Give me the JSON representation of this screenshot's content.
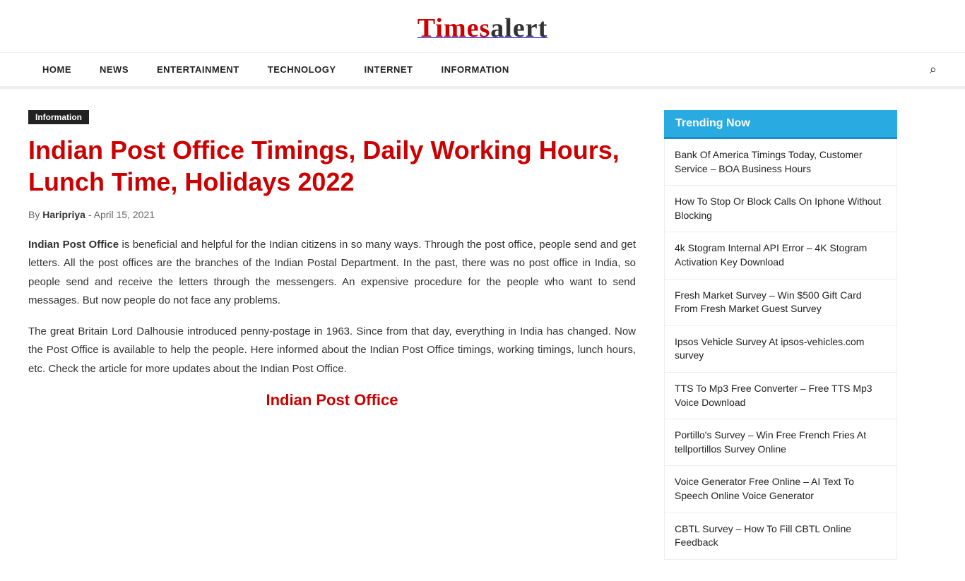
{
  "site": {
    "name_times": "Times",
    "name_alert": "alert"
  },
  "nav": {
    "items": [
      {
        "label": "HOME",
        "href": "#"
      },
      {
        "label": "NEWS",
        "href": "#"
      },
      {
        "label": "ENTERTAINMENT",
        "href": "#"
      },
      {
        "label": "TECHNOLOGY",
        "href": "#"
      },
      {
        "label": "INTERNET",
        "href": "#"
      },
      {
        "label": "INFORMATION",
        "href": "#"
      }
    ]
  },
  "article": {
    "category": "Information",
    "title": "Indian Post Office Timings, Daily Working Hours, Lunch Time, Holidays 2022",
    "author": "Haripriya",
    "date": "April 15, 2021",
    "by_label": "By",
    "separator": "-",
    "para1_bold": "Indian Post Office",
    "para1_rest": " is beneficial and helpful for the Indian citizens in so many ways. Through the post office, people send and get letters. All the post offices are the branches of the Indian Postal Department. In the past, there was no post office in India, so people send and receive the letters through the messengers. An expensive procedure for the people who want to send messages. But now people do not face any problems.",
    "para2": "The great Britain Lord Dalhousie introduced penny-postage in 1963. Since from that day, everything in India has changed. Now the Post Office is available to help the people. Here informed about the Indian Post Office timings, working timings, lunch hours, etc. Check the article for more updates about the Indian Post Office.",
    "subheading": "Indian Post Office"
  },
  "sidebar": {
    "trending_label": "Trending Now",
    "items": [
      {
        "text": "Bank Of America Timings Today, Customer Service – BOA Business Hours"
      },
      {
        "text": "How To Stop Or Block Calls On Iphone Without Blocking"
      },
      {
        "text": "4k Stogram Internal API Error – 4K Stogram Activation Key Download"
      },
      {
        "text": "Fresh Market Survey – Win $500 Gift Card From Fresh Market Guest Survey"
      },
      {
        "text": "Ipsos Vehicle Survey At ipsos-vehicles.com survey"
      },
      {
        "text": "TTS To Mp3 Free Converter – Free TTS Mp3 Voice Download"
      },
      {
        "text": "Portillo's Survey – Win Free French Fries At tellportillos Survey Online"
      },
      {
        "text": "Voice Generator Free Online – AI Text To Speech Online Voice Generator"
      },
      {
        "text": "CBTL Survey – How To Fill CBTL Online Feedback"
      }
    ]
  }
}
